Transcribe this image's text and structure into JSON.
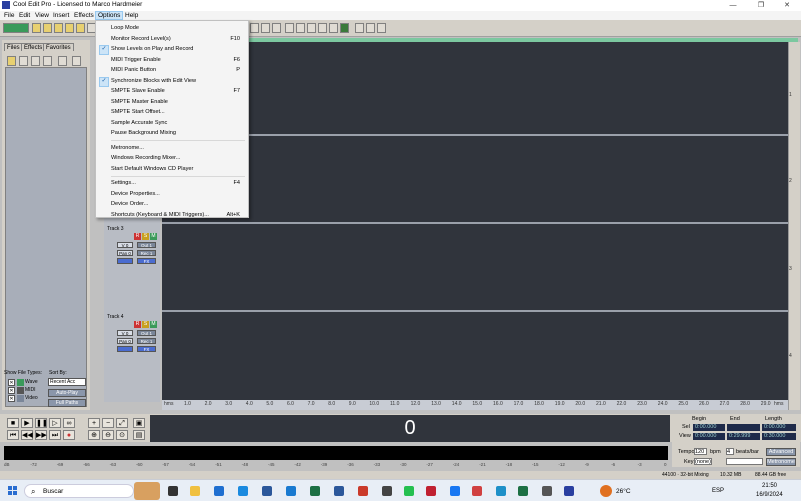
{
  "window": {
    "title": "Cool Edit Pro - Licensed to Marco Hardmeier",
    "controls": [
      "—",
      "❐",
      "✕"
    ]
  },
  "menubar": {
    "items": [
      "File",
      "Edit",
      "View",
      "Insert",
      "Effects",
      "Options",
      "Help"
    ],
    "active": "Options"
  },
  "options_menu": {
    "items": [
      {
        "label": "Loop Mode",
        "shortcut": "",
        "checked": false
      },
      {
        "label": "Monitor Record Level(s)",
        "shortcut": "F10",
        "checked": false
      },
      {
        "label": "Show Levels on Play and Record",
        "shortcut": "",
        "checked": true
      },
      {
        "label": "MIDI Trigger Enable",
        "shortcut": "F6",
        "checked": false
      },
      {
        "label": "MIDI Panic Button",
        "shortcut": "P",
        "checked": false
      },
      {
        "label": "Synchronize Blocks with Edit View",
        "shortcut": "",
        "checked": true
      },
      {
        "label": "SMPTE Slave Enable",
        "shortcut": "F7",
        "checked": false
      },
      {
        "label": "SMPTE Master Enable",
        "shortcut": "",
        "checked": false
      },
      {
        "label": "SMPTE Start Offset...",
        "shortcut": "",
        "checked": false
      },
      {
        "label": "Sample Accurate Sync",
        "shortcut": "",
        "checked": false
      },
      {
        "label": "Pause Background Mixing",
        "shortcut": "",
        "checked": false
      },
      {
        "label": "Metronome...",
        "shortcut": "",
        "checked": false
      },
      {
        "label": "Windows Recording Mixer...",
        "shortcut": "",
        "checked": false
      },
      {
        "label": "Start Default Windows CD Player",
        "shortcut": "",
        "checked": false
      },
      {
        "label": "Settings...",
        "shortcut": "F4",
        "checked": false
      },
      {
        "label": "Device Properties...",
        "shortcut": "",
        "checked": false
      },
      {
        "label": "Device Order...",
        "shortcut": "",
        "checked": false
      },
      {
        "label": "Shortcuts (Keyboard & MIDI Triggers)...",
        "shortcut": "Alt+K",
        "checked": false
      }
    ]
  },
  "left_panel": {
    "tabs": [
      "Files",
      "Effects",
      "Favorites"
    ],
    "show_file_types_label": "Show File Types:",
    "sort_by_label": "Sort By:",
    "file_types": [
      "Wave",
      "MIDI",
      "Video"
    ],
    "sort_value": "Recent Acc",
    "auto_play_label": "Auto-Play",
    "full_paths_label": "Full Paths"
  },
  "tracks": [
    {
      "name": "Track 3",
      "vol": "V 0",
      "pan": "Pan 0",
      "out": "Out 1",
      "rec": "Rec 1",
      "fx": "FX",
      "buttons": [
        "R",
        "S",
        "M"
      ]
    },
    {
      "name": "Track 4",
      "vol": "V 0",
      "pan": "Pan 0",
      "out": "Out 1",
      "rec": "Rec 1",
      "fx": "FX",
      "buttons": [
        "R",
        "S",
        "M"
      ]
    }
  ],
  "lane_numbers": [
    "1",
    "2",
    "3",
    "4"
  ],
  "ruler": {
    "start": "hms",
    "end": "hms",
    "ticks": [
      "1.0",
      "2.0",
      "3.0",
      "4.0",
      "5.0",
      "6.0",
      "7.0",
      "8.0",
      "9.0",
      "10.0",
      "11.0",
      "12.0",
      "13.0",
      "14.0",
      "15.0",
      "16.0",
      "17.0",
      "18.0",
      "19.0",
      "20.0",
      "21.0",
      "22.0",
      "23.0",
      "24.0",
      "25.0",
      "26.0",
      "27.0",
      "28.0",
      "29.0"
    ]
  },
  "time_display": "0",
  "selection": {
    "headers": [
      "Begin",
      "End",
      "Length"
    ],
    "sel_label": "Sel",
    "view_label": "View",
    "sel": [
      "0:00.000",
      "",
      "0:00.000"
    ],
    "view": [
      "0:00.000",
      "0:29.999",
      "0:30.000"
    ]
  },
  "tempo": {
    "tempo_label": "Tempo",
    "tempo_value": "120",
    "bpm_label": "bpm",
    "beats_value": "4",
    "beats_label": "beats/bar",
    "advanced_label": "Advanced",
    "key_label": "Key",
    "key_value": "(none)",
    "metronome_label": "Metronome"
  },
  "level_ticks": [
    "dB",
    "-72",
    "-69",
    "-66",
    "-63",
    "-60",
    "-57",
    "-54",
    "-51",
    "-48",
    "-45",
    "-42",
    "-39",
    "-36",
    "-33",
    "-30",
    "-27",
    "-24",
    "-21",
    "-18",
    "-15",
    "-12",
    "-9",
    "-6",
    "-3",
    "0"
  ],
  "status": {
    "mixing": "44100 · 32-bit Mixing",
    "size": "10.32 MB",
    "free": "88.44 GB free"
  },
  "taskbar": {
    "search_placeholder": "Buscar",
    "weather": "26°C",
    "lang": "ESP",
    "time": "21:50",
    "date": "16/9/2024"
  },
  "colors": {
    "waveform_bg": "#30343c",
    "menu_highlight": "#cce4f7",
    "accent_green": "#7cc8a0"
  }
}
